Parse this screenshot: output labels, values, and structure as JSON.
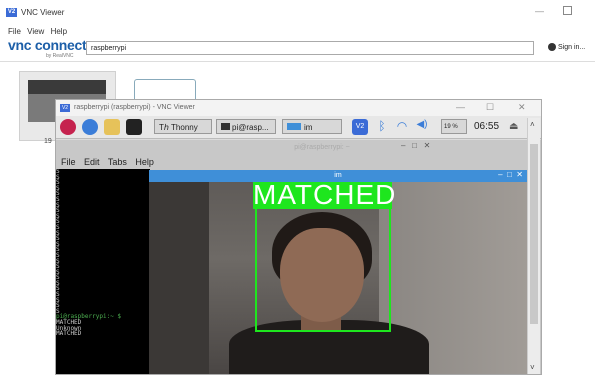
{
  "outer": {
    "title": "VNC Viewer",
    "logo_badge": "V2",
    "menu": [
      "File",
      "View",
      "Help"
    ],
    "brand": "vnc connect",
    "brand_sub": "by RealVNC",
    "address": "raspberrypi",
    "sign_in": "Sign in...",
    "thumb_label": "19"
  },
  "inner": {
    "title": "raspberrypi (raspberrypi) - VNC Viewer",
    "badge": "V2"
  },
  "taskbar": {
    "thonny": "Thonny",
    "terminal": "pi@rasp...",
    "im": "im",
    "cpu": "19 %",
    "clock": "06:55"
  },
  "terminal": {
    "title": "pi@raspberrypi: ~",
    "menu": [
      "File",
      "Edit",
      "Tabs",
      "Help"
    ],
    "s_lines": [
      "S",
      "S",
      "S",
      "S",
      "S",
      "S",
      "S",
      "S",
      "S",
      "S",
      "S",
      "S",
      "S",
      "S",
      "S",
      "S",
      "S",
      "S",
      "S",
      "S",
      "S",
      "S",
      "S",
      "S",
      "S",
      "S"
    ],
    "prompt": "pi@raspberrypi:~ $",
    "output": [
      "MATCHED",
      "Unknown",
      "MATCHED"
    ]
  },
  "im_window": {
    "title": "im",
    "result_label": "MATCHED"
  },
  "colors": {
    "match_green": "#1ee61e",
    "title_blue": "#3f8fd8",
    "brand_blue": "#1d5fa8"
  }
}
